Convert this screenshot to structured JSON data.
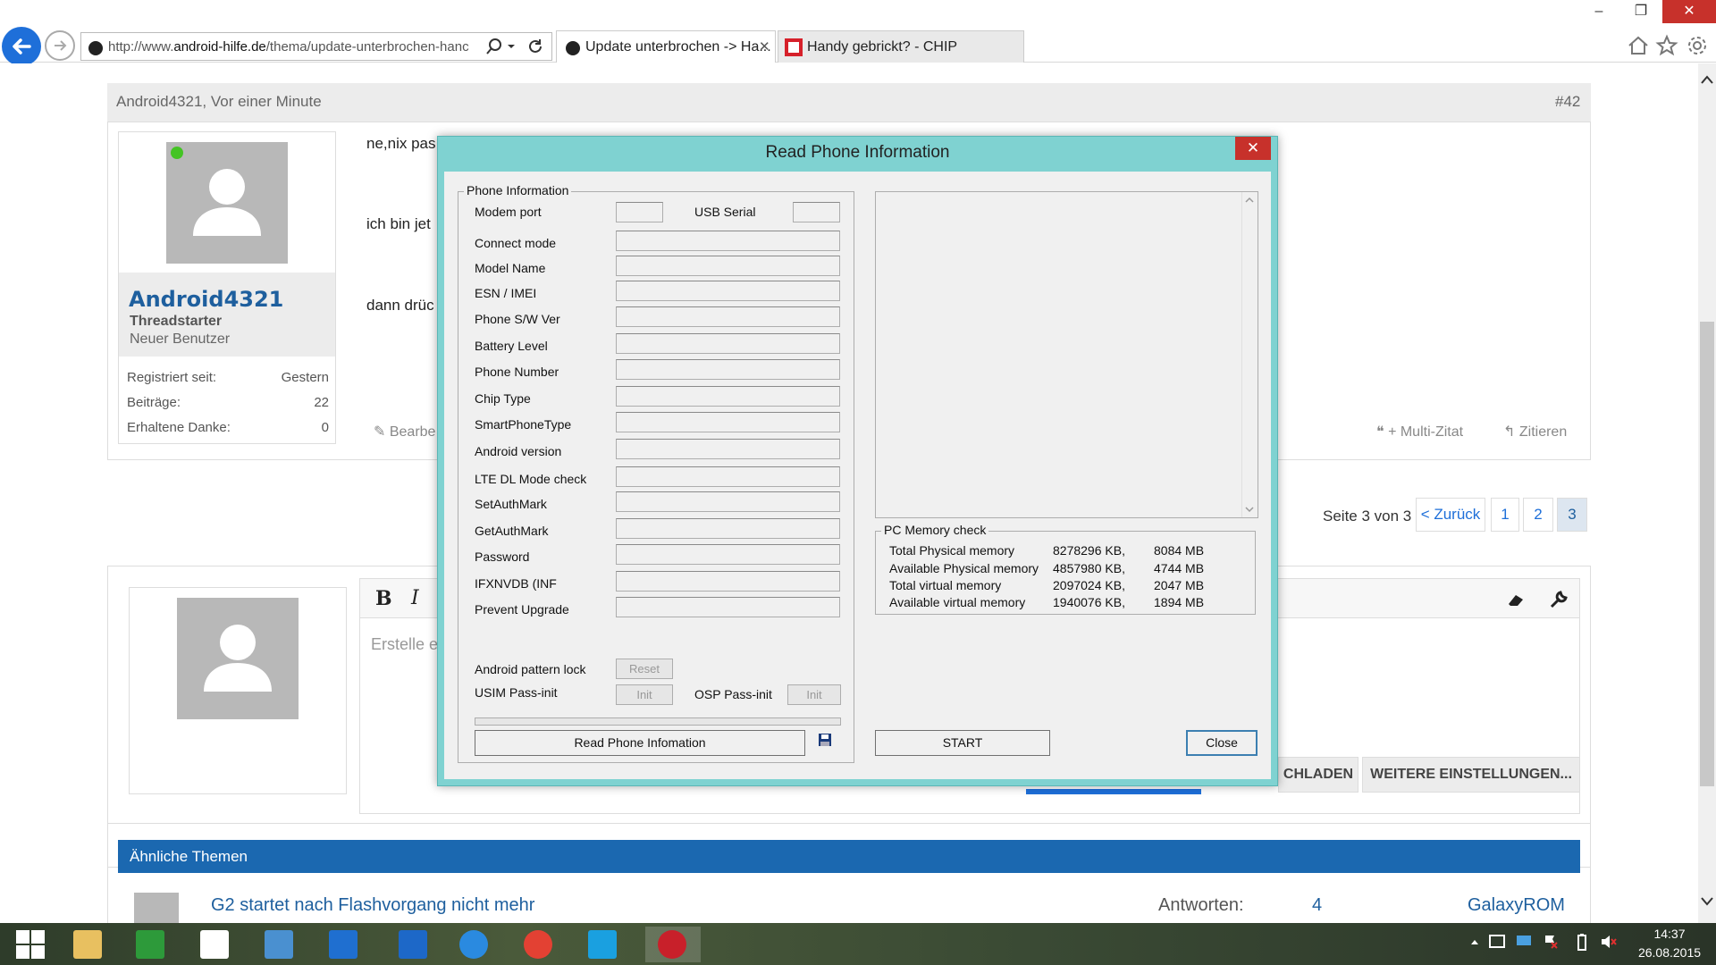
{
  "browser": {
    "url_prefix": "http://www.",
    "url_domain": "android-hilfe.de",
    "url_path": "/thema/update-unterbrochen-hanc",
    "tabs": [
      {
        "label": "Update unterbrochen -> Ha..."
      },
      {
        "label": "Handy gebrickt? - CHIP"
      }
    ],
    "window_controls": {
      "minimize": "–",
      "restore": "❐",
      "close": "✕"
    }
  },
  "post": {
    "author_time": "Android4321, Vor einer Minute",
    "number": "#42",
    "lines": [
      "ne,nix pas",
      "ich bin jet",
      "dann drüc"
    ],
    "edit": "Bearbe",
    "multiquote": "+ Multi-Zitat",
    "quote": "Zitieren"
  },
  "user": {
    "name": "Android4321",
    "role": "Threadstarter",
    "rank": "Neuer Benutzer",
    "stats": [
      {
        "label": "Registriert seit:",
        "value": "Gestern"
      },
      {
        "label": "Beiträge:",
        "value": "22"
      },
      {
        "label": "Erhaltene Danke:",
        "value": "0"
      }
    ]
  },
  "pagination": {
    "label": "Seite 3 von 3",
    "back": "< Zurück",
    "pages": [
      "1",
      "2",
      "3"
    ]
  },
  "reply": {
    "bold": "B",
    "italic": "I",
    "placeholder": "Erstelle e",
    "load_button": "CHLADEN",
    "more_settings": "WEITERE EINSTELLUNGEN..."
  },
  "similar": {
    "header": "Ähnliche Themen",
    "topic": "G2 startet nach Flashvorgang nicht mehr",
    "answers_label": "Antworten:",
    "answers": "4",
    "author": "GalaxyROM"
  },
  "dialog": {
    "title": "Read Phone Information",
    "close_x": "✕",
    "phone_group": "Phone Information",
    "modem_port": "Modem port",
    "usb_serial": "USB Serial",
    "fields": [
      "Connect mode",
      "Model Name",
      "ESN / IMEI",
      "Phone S/W Ver",
      "Battery Level",
      "Phone Number",
      "Chip Type",
      "SmartPhoneType",
      "Android version",
      "LTE DL Mode check",
      "SetAuthMark",
      "GetAuthMark",
      "Password",
      "IFXNVDB (INF",
      "Prevent Upgrade"
    ],
    "pattern_lock": "Android pattern lock",
    "reset": "Reset",
    "usim": "USIM Pass-init",
    "init1": "Init",
    "osp": "OSP Pass-init",
    "init2": "Init",
    "read_button": "Read Phone Infomation",
    "mem_group": "PC Memory check",
    "memory": [
      {
        "label": "Total Physical memory",
        "kb": "8278296 KB,",
        "mb": "8084 MB"
      },
      {
        "label": "Available Physical memory",
        "kb": "4857980 KB,",
        "mb": "4744 MB"
      },
      {
        "label": "Total virtual memory",
        "kb": "2097024 KB,",
        "mb": "2047 MB"
      },
      {
        "label": "Available virtual memory",
        "kb": "1940076 KB,",
        "mb": "1894 MB"
      }
    ],
    "start": "START",
    "close": "Close"
  },
  "taskbar": {
    "time": "14:37",
    "date": "26.08.2015",
    "apps": [
      "start-icon",
      "file-explorer-icon",
      "store-icon",
      "home-icon",
      "mail-icon",
      "monitor-icon",
      "maxthon-icon",
      "internet-explorer-icon",
      "chrome-icon",
      "skype-icon",
      "lg-icon"
    ]
  },
  "colors": {
    "accent": "#1e6fd9",
    "dialog_frame": "#7fd2d1",
    "close_red": "#c7312b",
    "link": "#1e5f9e"
  }
}
